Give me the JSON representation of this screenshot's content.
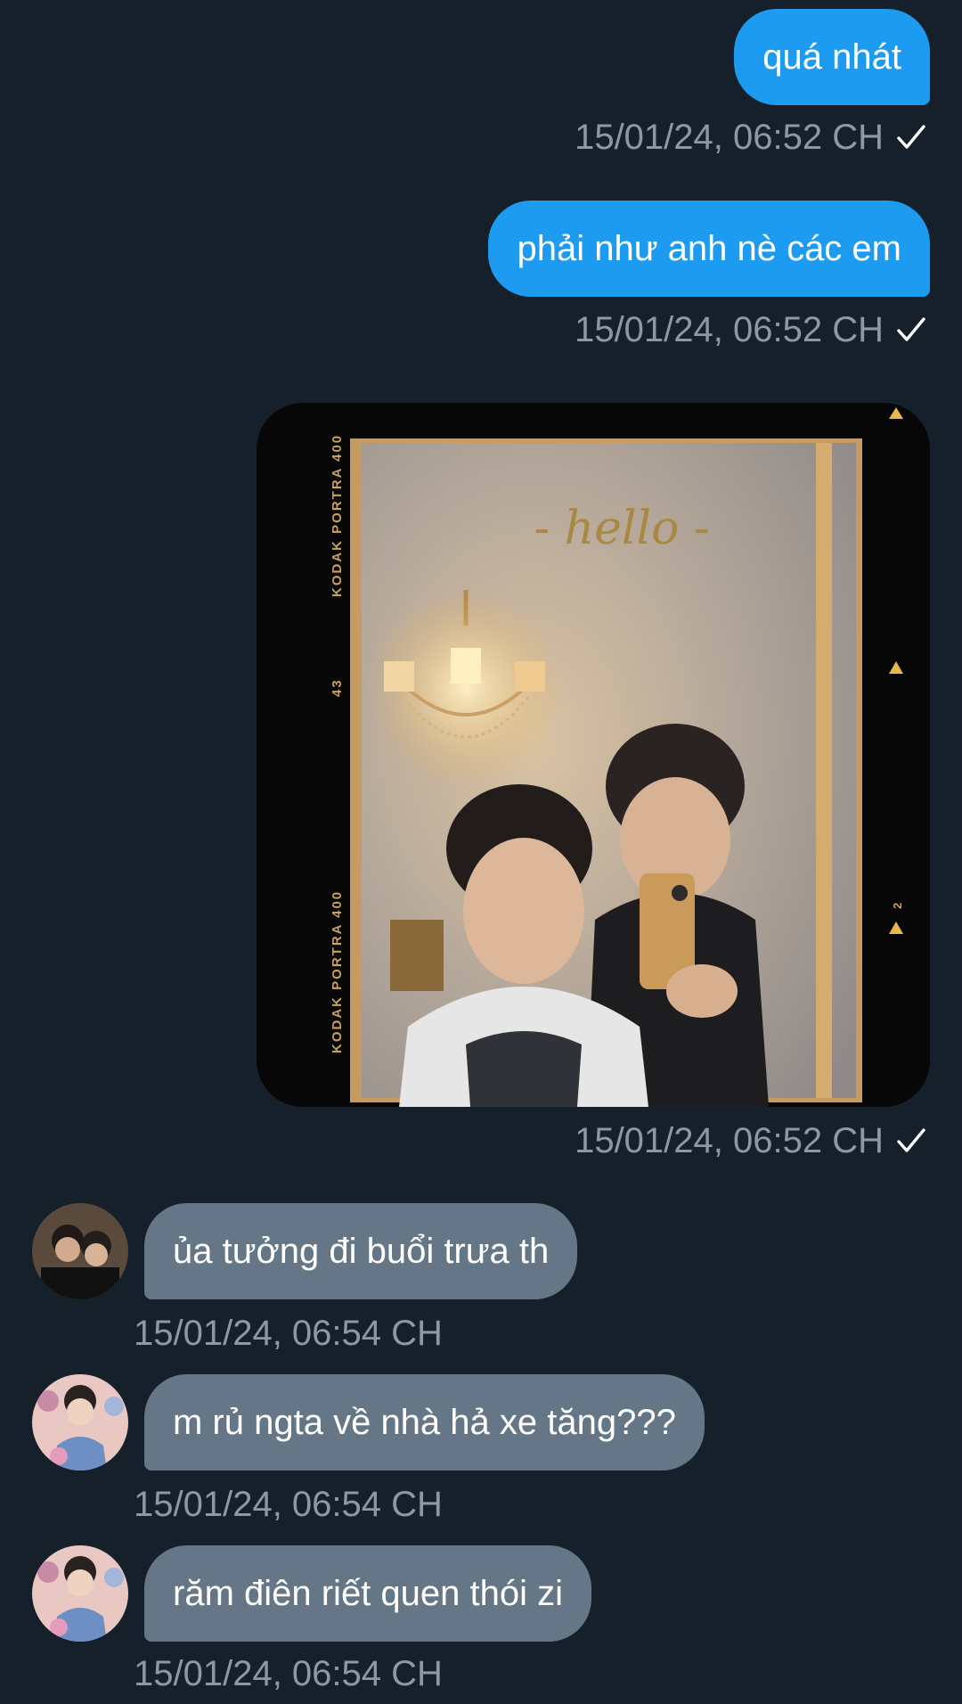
{
  "messages": [
    {
      "id": "m1",
      "direction": "outgoing",
      "text": "quá nhát",
      "time": "15/01/24, 06:52 CH",
      "status_icon": "check-icon"
    },
    {
      "id": "m2",
      "direction": "outgoing",
      "text": "phải như anh nè các em",
      "time": "15/01/24, 06:52 CH",
      "status_icon": "check-icon"
    },
    {
      "id": "m3",
      "direction": "outgoing",
      "type": "image",
      "image_text": {
        "caption": "- hello -",
        "film_left_top": "KODAK PORTRA 400",
        "film_left_mid": "43",
        "film_left_bottom": "KODAK PORTRA 400",
        "film_right": "2"
      },
      "time": "15/01/24, 06:52 CH",
      "status_icon": "check-icon"
    },
    {
      "id": "m4",
      "direction": "incoming",
      "text": "ủa tưởng đi buổi trưa th",
      "time": "15/01/24, 06:54 CH",
      "avatar": "avatar-icon"
    },
    {
      "id": "m5",
      "direction": "incoming",
      "text": "m rủ ngta về nhà hả xe tăng???",
      "time": "15/01/24, 06:54 CH",
      "avatar": "avatar-icon"
    },
    {
      "id": "m6",
      "direction": "incoming",
      "text": "răm điên riết quen thói zi",
      "time": "15/01/24, 06:54 CH",
      "avatar": "avatar-icon"
    }
  ],
  "colors": {
    "background": "#15202b",
    "outgoing_bubble": "#1d9bf0",
    "incoming_bubble": "#657786",
    "timestamp": "#8b98a5"
  }
}
